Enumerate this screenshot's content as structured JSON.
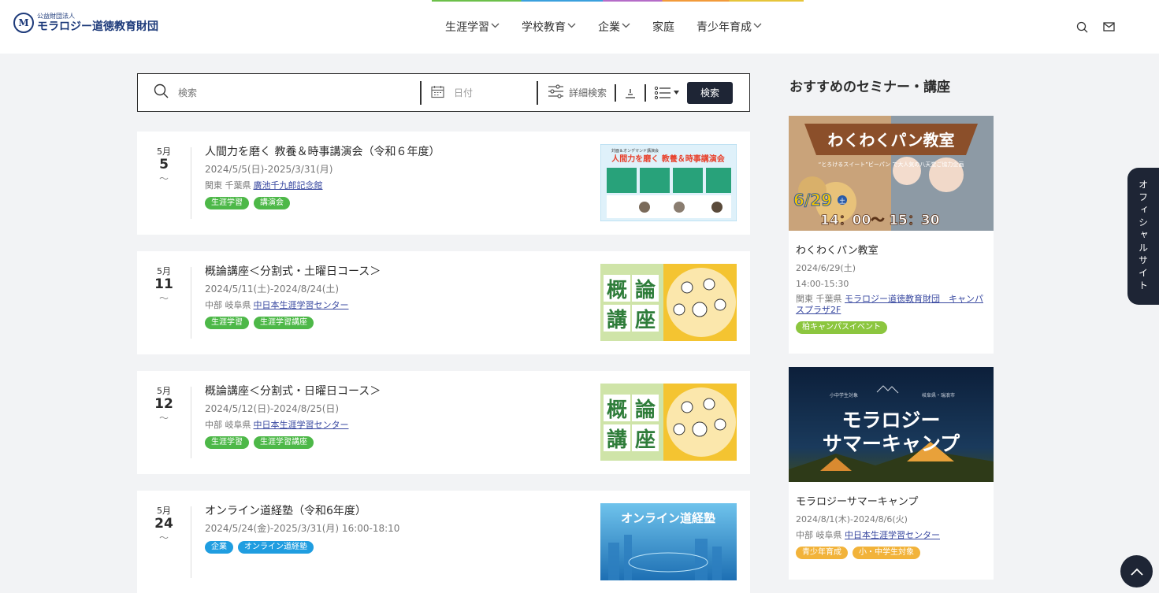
{
  "header": {
    "logo_sub": "公益財団法人",
    "logo_main": "モラロジー道徳教育財団",
    "logo_mark": "M",
    "nav": [
      {
        "label": "生涯学習",
        "dropdown": true
      },
      {
        "label": "学校教育",
        "dropdown": true
      },
      {
        "label": "企業",
        "dropdown": true
      },
      {
        "label": "家庭",
        "dropdown": false
      },
      {
        "label": "青少年育成",
        "dropdown": true
      }
    ],
    "icons": [
      "search-icon",
      "mail-icon"
    ]
  },
  "search": {
    "keyword_placeholder": "検索",
    "date_placeholder": "日付",
    "advanced_label": "詳細検索",
    "submit_label": "検索"
  },
  "events": [
    {
      "month": "5月",
      "day": "5",
      "tilde": "〜",
      "title": "人間力を磨く 教養＆時事講演会（令和６年度）",
      "range": "2024/5/5(日)-2025/3/31(月)",
      "region": "関東 千葉県",
      "venue": "廣池千九郎記念館",
      "tags": [
        {
          "label": "生涯学習",
          "color": "green"
        },
        {
          "label": "講演会",
          "color": "green"
        }
      ],
      "thumb": {
        "kind": "lecture",
        "headline": "人間力を磨く 教養＆時事講演会",
        "top": "対面＆オンデマンド講演会"
      }
    },
    {
      "month": "5月",
      "day": "11",
      "tilde": "〜",
      "title": "概論講座＜分割式・土曜日コース＞",
      "range": "2024/5/11(土)-2024/8/24(土)",
      "region": "中部 岐阜県",
      "venue": "中日本生涯学習センター",
      "tags": [
        {
          "label": "生涯学習",
          "color": "green"
        },
        {
          "label": "生涯学習講座",
          "color": "green"
        }
      ],
      "thumb": {
        "kind": "gairon",
        "chars": [
          "概",
          "論",
          "講",
          "座"
        ]
      }
    },
    {
      "month": "5月",
      "day": "12",
      "tilde": "〜",
      "title": "概論講座＜分割式・日曜日コース＞",
      "range": "2024/5/12(日)-2024/8/25(日)",
      "region": "中部 岐阜県",
      "venue": "中日本生涯学習センター",
      "tags": [
        {
          "label": "生涯学習",
          "color": "green"
        },
        {
          "label": "生涯学習講座",
          "color": "green"
        }
      ],
      "thumb": {
        "kind": "gairon",
        "chars": [
          "概",
          "論",
          "講",
          "座"
        ]
      }
    },
    {
      "month": "5月",
      "day": "24",
      "tilde": "〜",
      "title": "オンライン道経塾（令和6年度）",
      "range": "2024/5/24(金)-2025/3/31(月) 16:00-18:10",
      "region": "",
      "venue": "",
      "tags": [
        {
          "label": "企業",
          "color": "blue"
        },
        {
          "label": "オンライン道経塾",
          "color": "blue"
        }
      ],
      "thumb": {
        "kind": "online",
        "headline": "オンライン道経塾"
      }
    }
  ],
  "sidebar": {
    "heading": "おすすめのセミナー・講座",
    "cards": [
      {
        "title": "わくわくパン教室",
        "lines": [
          "2024/6/29(土)",
          "14:00-15:30"
        ],
        "region": "関東 千葉県",
        "venue": "モラロジー道徳教育財団　キャンパスプラザ2F",
        "tags": [
          {
            "label": "柏キャンパスイベント",
            "color": "lime"
          }
        ],
        "thumb": {
          "kind": "bread",
          "banner": "わくわくパン教室",
          "sub": "“とろけるスイート”ビーパン で大人気の八天堂ご協力企画",
          "date": "6/29",
          "dow": "土",
          "time": "14：00〜 15：30"
        }
      },
      {
        "title": "モラロジーサマーキャンプ",
        "lines": [
          "2024/8/1(木)-2024/8/6(火)"
        ],
        "region": "中部 岐阜県",
        "venue": "中日本生涯学習センター",
        "tags": [
          {
            "label": "青少年育成",
            "color": "amber"
          },
          {
            "label": "小・中学生対象",
            "color": "amber"
          }
        ],
        "thumb": {
          "kind": "camp",
          "line1": "モラロジー",
          "line2": "サマーキャンプ",
          "small_left": "小中学生対象",
          "small_right": "岐阜県・瑞浪市"
        }
      }
    ]
  },
  "official_tab": "オフィシャルサイト",
  "colors": {
    "navy": "#1e2535",
    "green": "#4db848",
    "blue": "#1f9de0",
    "lime": "#8cc63f",
    "amber": "#f2b33a",
    "link": "#3848a0"
  }
}
